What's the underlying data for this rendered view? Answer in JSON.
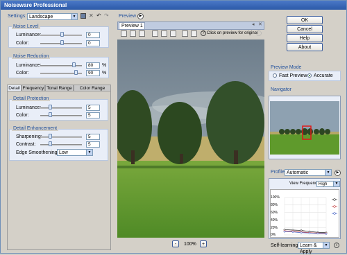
{
  "title": "Noiseware Professional",
  "settings": {
    "label": "Settings:",
    "value": "Landscape"
  },
  "noise_level": {
    "title": "Noise Level",
    "luminance_label": "Luminance:",
    "luminance_value": "0",
    "color_label": "Color:",
    "color_value": "0"
  },
  "noise_reduction": {
    "title": "Noise Reduction",
    "luminance_label": "Luminance:",
    "luminance_value": "80",
    "color_label": "Color:",
    "color_value": "90",
    "pct": "%"
  },
  "tabs": [
    "Detail",
    "Frequency",
    "Tonal Range",
    "Color Range"
  ],
  "detail_protection": {
    "title": "Detail Protection",
    "luminance_label": "Luminance:",
    "luminance_value": "5",
    "color_label": "Color:",
    "color_value": "5"
  },
  "detail_enhancement": {
    "title": "Detail Enhancement",
    "sharpening_label": "Sharpening:",
    "sharpening_value": "5",
    "contrast_label": "Contrast:",
    "contrast_value": "5",
    "edge_label": "Edge Smoothening:",
    "edge_value": "Low"
  },
  "preview": {
    "label": "Preview",
    "tab": "Preview 1",
    "hint": "Click on preview for original",
    "zoom": "100%",
    "minus": "-",
    "plus": "+"
  },
  "buttons": {
    "ok": "OK",
    "cancel": "Cancel",
    "help": "Help",
    "about": "About"
  },
  "preview_mode": {
    "title": "Preview Mode",
    "fast": "Fast Preview",
    "accurate": "Accurate"
  },
  "navigator": {
    "title": "Navigator"
  },
  "profile": {
    "label": "Profile:",
    "value": "Automatic",
    "freq_label": "View Frequency:",
    "freq_value": "High",
    "self_learning_label": "Self-learning:",
    "self_learning_value": "Learn & Apply"
  },
  "chart_data": {
    "type": "line",
    "y_ticks": [
      "100%",
      "80%",
      "60%",
      "40%",
      "20%",
      "0%"
    ],
    "series": [
      {
        "values": [
          14,
          13,
          12,
          9,
          7,
          6
        ]
      },
      {
        "values": [
          11,
          10,
          8,
          6,
          5,
          4
        ]
      },
      {
        "values": [
          9,
          8,
          6,
          5,
          4,
          3
        ]
      }
    ]
  }
}
